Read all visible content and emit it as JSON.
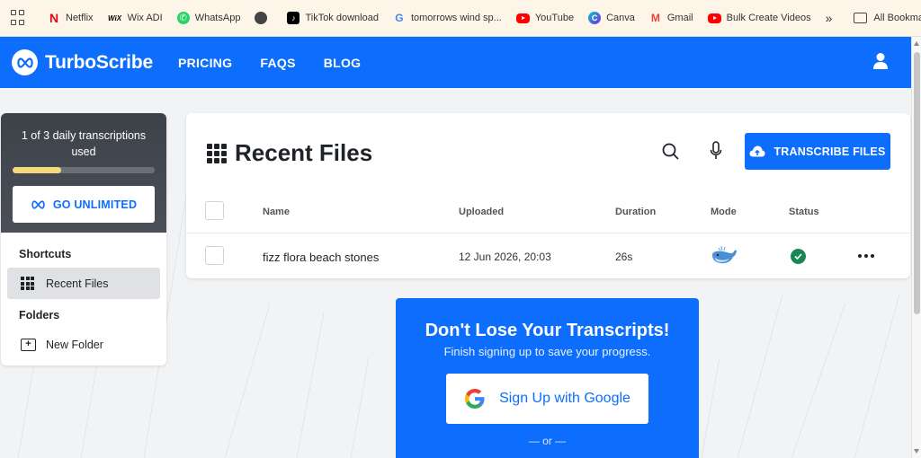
{
  "bookmarks": {
    "items": [
      {
        "label": "Netflix",
        "icon": "netflix-icon"
      },
      {
        "label": "Wix ADI",
        "icon": "wix-icon"
      },
      {
        "label": "WhatsApp",
        "icon": "whatsapp-icon"
      },
      {
        "label": "",
        "icon": "globe-icon"
      },
      {
        "label": "TikTok download",
        "icon": "tiktok-icon"
      },
      {
        "label": "tomorrows wind sp...",
        "icon": "google-icon"
      },
      {
        "label": "YouTube",
        "icon": "youtube-icon"
      },
      {
        "label": "Canva",
        "icon": "canva-icon"
      },
      {
        "label": "Gmail",
        "icon": "gmail-icon"
      },
      {
        "label": "Bulk Create Videos",
        "icon": "youtube-icon"
      }
    ],
    "more": "»",
    "all_bookmarks": "All Bookmarks"
  },
  "navbar": {
    "brand": "TurboScribe",
    "links": [
      "PRICING",
      "FAQS",
      "BLOG"
    ]
  },
  "sidebar": {
    "usage_text": "1 of 3 daily transcriptions used",
    "usage_progress": 0.34,
    "go_unlimited": "GO UNLIMITED",
    "shortcuts_heading": "Shortcuts",
    "recent_files": "Recent Files",
    "folders_heading": "Folders",
    "new_folder": "New Folder"
  },
  "main": {
    "title": "Recent Files",
    "transcribe_button": "TRANSCRIBE FILES",
    "columns": {
      "name": "Name",
      "uploaded": "Uploaded",
      "duration": "Duration",
      "mode": "Mode",
      "status": "Status"
    },
    "rows": [
      {
        "name": "fizz flora beach stones",
        "uploaded": "12 Jun 2026, 20:03",
        "duration": "26s",
        "mode": "whale-icon",
        "status": "completed"
      }
    ]
  },
  "promo": {
    "title": "Don't Lose Your Transcripts!",
    "subtitle": "Finish signing up to save your progress.",
    "google_button": "Sign Up with Google",
    "or_text": "— or —"
  },
  "colors": {
    "primary": "#0d6efd",
    "progress": "#f4d97a",
    "success": "#198754"
  }
}
